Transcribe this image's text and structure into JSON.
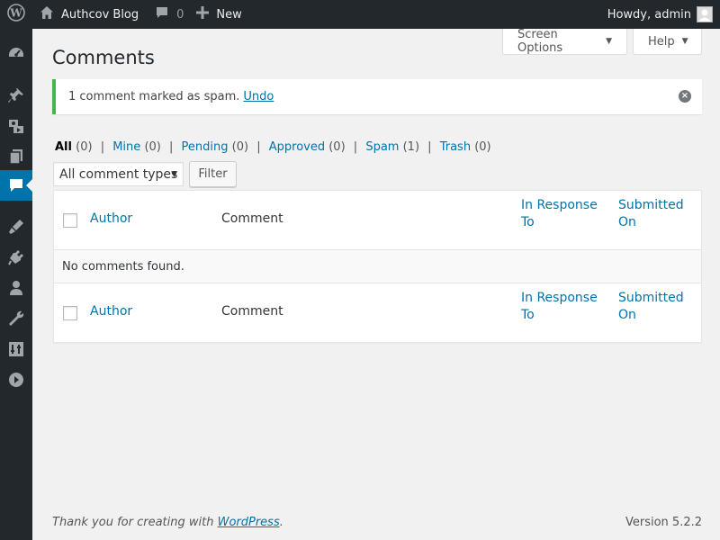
{
  "admin_bar": {
    "site_name": "Authcov Blog",
    "comments_count": "0",
    "new_label": "New",
    "howdy": "Howdy, admin",
    "icons": [
      "wordpress-icon",
      "home-icon",
      "comment-bubble-icon",
      "plus-icon",
      "avatar"
    ]
  },
  "menu": {
    "icons": [
      "dashboard-icon",
      "posts-icon",
      "media-icon",
      "pages-icon",
      "comments-icon",
      "appearance-icon",
      "plugins-icon",
      "users-icon",
      "tools-icon",
      "settings-icon",
      "collapse-icon"
    ],
    "current": "comments-icon",
    "accent": "#0073aa"
  },
  "screen_meta": {
    "screen_options": "Screen Options",
    "help": "Help"
  },
  "page": {
    "title": "Comments"
  },
  "notice": {
    "message": "1 comment marked as spam.",
    "undo": "Undo",
    "accent": "#46b450"
  },
  "views": [
    {
      "label": "All",
      "count": "(0)",
      "current": true
    },
    {
      "label": "Mine",
      "count": "(0)"
    },
    {
      "label": "Pending",
      "count": "(0)"
    },
    {
      "label": "Approved",
      "count": "(0)"
    },
    {
      "label": "Spam",
      "count": "(1)"
    },
    {
      "label": "Trash",
      "count": "(0)"
    }
  ],
  "filter": {
    "comment_type": "All comment types",
    "button": "Filter"
  },
  "table": {
    "columns": {
      "author": "Author",
      "comment": "Comment",
      "in_response_to": "In Response To",
      "submitted_on": "Submitted On"
    },
    "empty_message": "No comments found."
  },
  "footer": {
    "thanks_prefix": "Thank you for creating with",
    "wordpress_link": "WordPress",
    "period": ".",
    "version": "Version 5.2.2"
  }
}
